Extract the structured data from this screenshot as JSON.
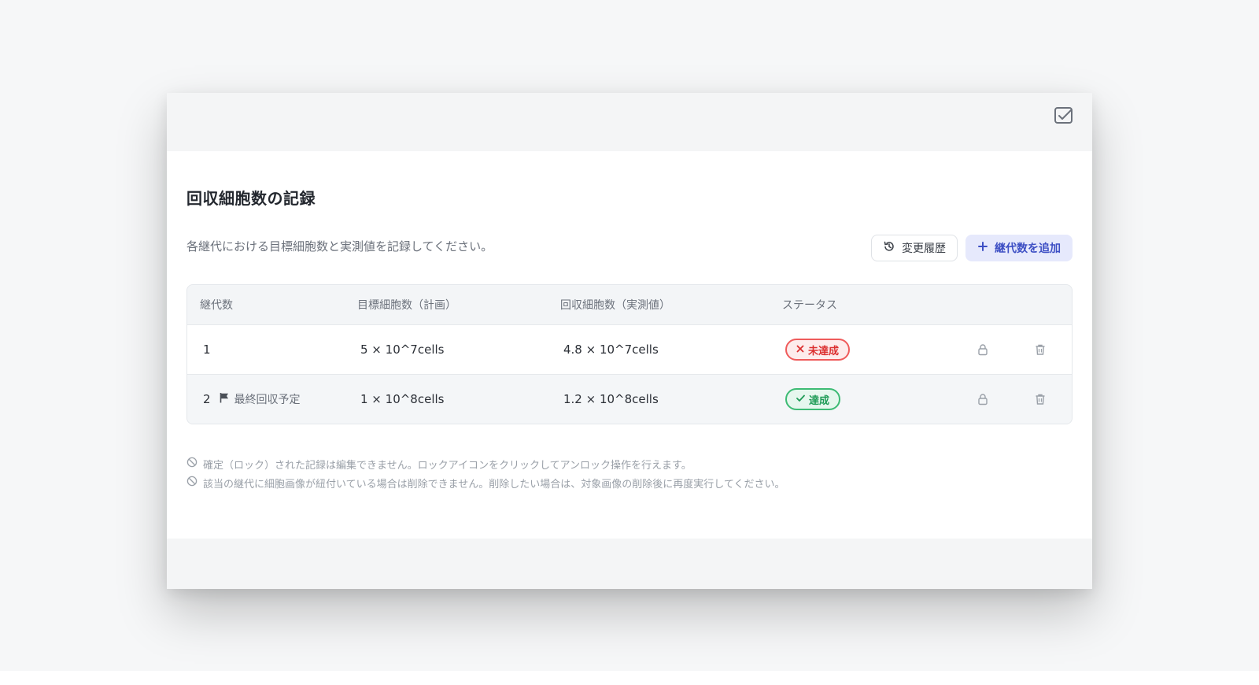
{
  "page": {
    "title": "回収細胞数の記録",
    "description": "各継代における目標細胞数と実測値を記録してください。"
  },
  "actions": {
    "history_label": "変更履歴",
    "add_label": "継代数を追加"
  },
  "table": {
    "headers": [
      "継代数",
      "目標細胞数（計画）",
      "回収細胞数（実測値）",
      "ステータス"
    ],
    "rows": [
      {
        "passage": "1",
        "tag": "",
        "target": "5 × 10^7cells",
        "actual": "4.8 × 10^7cells",
        "status": "未達成",
        "status_type": "ng"
      },
      {
        "passage": "2",
        "tag": "最終回収予定",
        "target": "1 × 10^8cells",
        "actual": "1.2 × 10^8cells",
        "status": "達成",
        "status_type": "ok"
      }
    ]
  },
  "notes": [
    "確定（ロック）された記録は編集できません。ロックアイコンをクリックしてアンロック操作を行えます。",
    "該当の継代に細胞画像が紐付いている場合は削除できません。削除したい場合は、対象画像の削除後に再度実行してください。"
  ],
  "colors": {
    "accent": "#3d4fc4",
    "status_ng": "#dc3030",
    "status_ok": "#1e9b56"
  },
  "icons": {
    "header": "checkbox-icon",
    "history": "history-icon",
    "add": "plus-icon",
    "flag": "flag-icon",
    "lock": "lock-icon",
    "delete": "trash-icon",
    "note": "ban-icon"
  }
}
